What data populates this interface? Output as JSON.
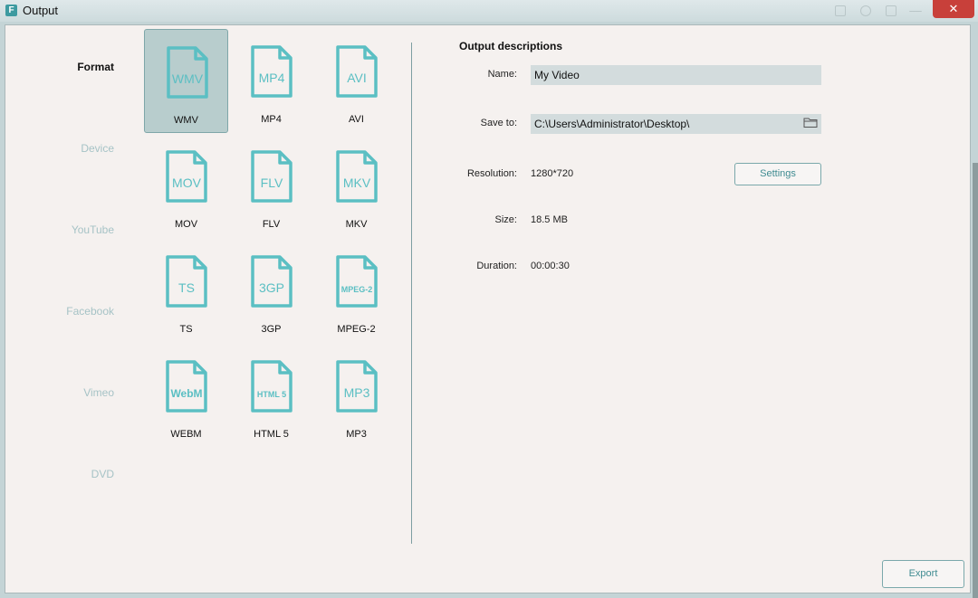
{
  "window": {
    "title": "Output",
    "close_symbol": "✕"
  },
  "sidebar": {
    "items": [
      {
        "label": "Format",
        "active": true
      },
      {
        "label": "Device",
        "active": false
      },
      {
        "label": "YouTube",
        "active": false
      },
      {
        "label": "Facebook",
        "active": false
      },
      {
        "label": "Vimeo",
        "active": false
      },
      {
        "label": "DVD",
        "active": false
      }
    ]
  },
  "formats": [
    {
      "icon_text": "WMV",
      "label": "WMV",
      "selected": true
    },
    {
      "icon_text": "MP4",
      "label": "MP4"
    },
    {
      "icon_text": "AVI",
      "label": "AVI"
    },
    {
      "icon_text": "MOV",
      "label": "MOV"
    },
    {
      "icon_text": "FLV",
      "label": "FLV"
    },
    {
      "icon_text": "MKV",
      "label": "MKV"
    },
    {
      "icon_text": "TS",
      "label": "TS"
    },
    {
      "icon_text": "3GP",
      "label": "3GP"
    },
    {
      "icon_text": "MPEG-2",
      "label": "MPEG-2"
    },
    {
      "icon_text": "WebM",
      "label": "WEBM"
    },
    {
      "icon_text": "HTML 5",
      "label": "HTML 5"
    },
    {
      "icon_text": "MP3",
      "label": "MP3"
    }
  ],
  "output": {
    "heading": "Output descriptions",
    "name_label": "Name:",
    "name_value": "My Video",
    "save_label": "Save to:",
    "save_value": "C:\\Users\\Administrator\\Desktop\\",
    "resolution_label": "Resolution:",
    "resolution_value": "1280*720",
    "settings_button": "Settings",
    "size_label": "Size:",
    "size_value": "18.5 MB",
    "duration_label": "Duration:",
    "duration_value": "00:00:30"
  },
  "footer": {
    "export_button": "Export"
  },
  "colors": {
    "accent": "#5bbfc3",
    "selected_bg": "#b8cdcd",
    "close": "#c8403a"
  }
}
